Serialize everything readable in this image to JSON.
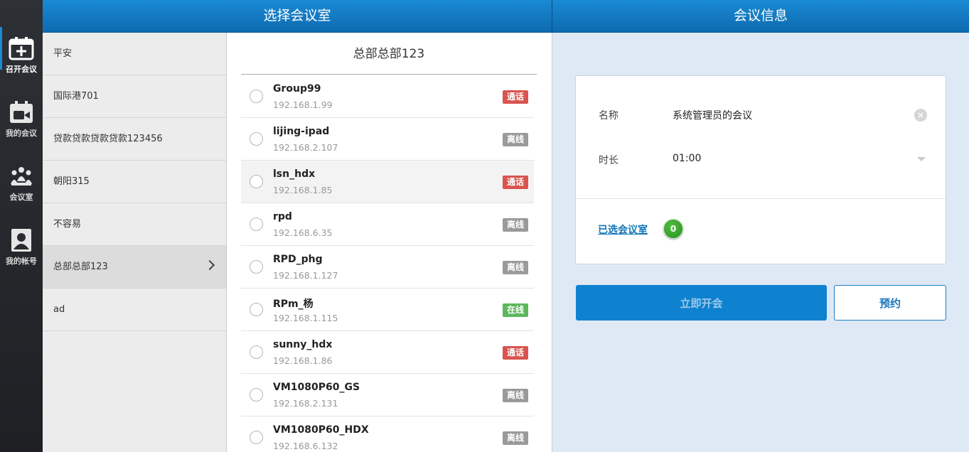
{
  "colors": {
    "header_blue": "#0d6bb0",
    "accent": "#0e82cf",
    "badge_call": "#d9534f",
    "badge_offline": "#9a9a9a",
    "badge_online": "#5cb85c",
    "count_green": "#2a8d22"
  },
  "nav": {
    "items": [
      {
        "label": "召开会议",
        "icon": "calendar-add-icon"
      },
      {
        "label": "我的会议",
        "icon": "calendar-video-icon"
      },
      {
        "label": "会议室",
        "icon": "meeting-room-icon"
      },
      {
        "label": "我的帐号",
        "icon": "account-icon"
      }
    ]
  },
  "headers": {
    "left": "选择会议室",
    "right": "会议信息"
  },
  "rooms": [
    {
      "name": "平安"
    },
    {
      "name": "国际港701"
    },
    {
      "name": "贷款贷款贷款贷款123456"
    },
    {
      "name": "朝阳315"
    },
    {
      "name": "不容易"
    },
    {
      "name": "总部总部123"
    },
    {
      "name": "ad"
    }
  ],
  "devices_panel": {
    "title": "总部总部123",
    "items": [
      {
        "name": "Group99",
        "ip": "192.168.1.99",
        "status": "通话"
      },
      {
        "name": "lijing-ipad",
        "ip": "192.168.2.107",
        "status": "离线"
      },
      {
        "name": "lsn_hdx",
        "ip": "192.168.1.85",
        "status": "通话"
      },
      {
        "name": "rpd",
        "ip": "192.168.6.35",
        "status": "离线"
      },
      {
        "name": "RPD_phg",
        "ip": "192.168.1.127",
        "status": "离线"
      },
      {
        "name": "RPm_杨",
        "ip": "192.168.1.115",
        "status": "在线"
      },
      {
        "name": "sunny_hdx",
        "ip": "192.168.1.86",
        "status": "通话"
      },
      {
        "name": "VM1080P60_GS",
        "ip": "192.168.2.131",
        "status": "离线"
      },
      {
        "name": "VM1080P60_HDX",
        "ip": "192.168.6.132",
        "status": "离线"
      }
    ]
  },
  "meeting_info": {
    "name_label": "名称",
    "name_value": "系统管理员的会议",
    "duration_label": "时长",
    "duration_value": "01:00",
    "selected_rooms_label": "已选会议室",
    "selected_rooms_count": "0",
    "start_button": "立即开会",
    "book_button": "预约"
  }
}
